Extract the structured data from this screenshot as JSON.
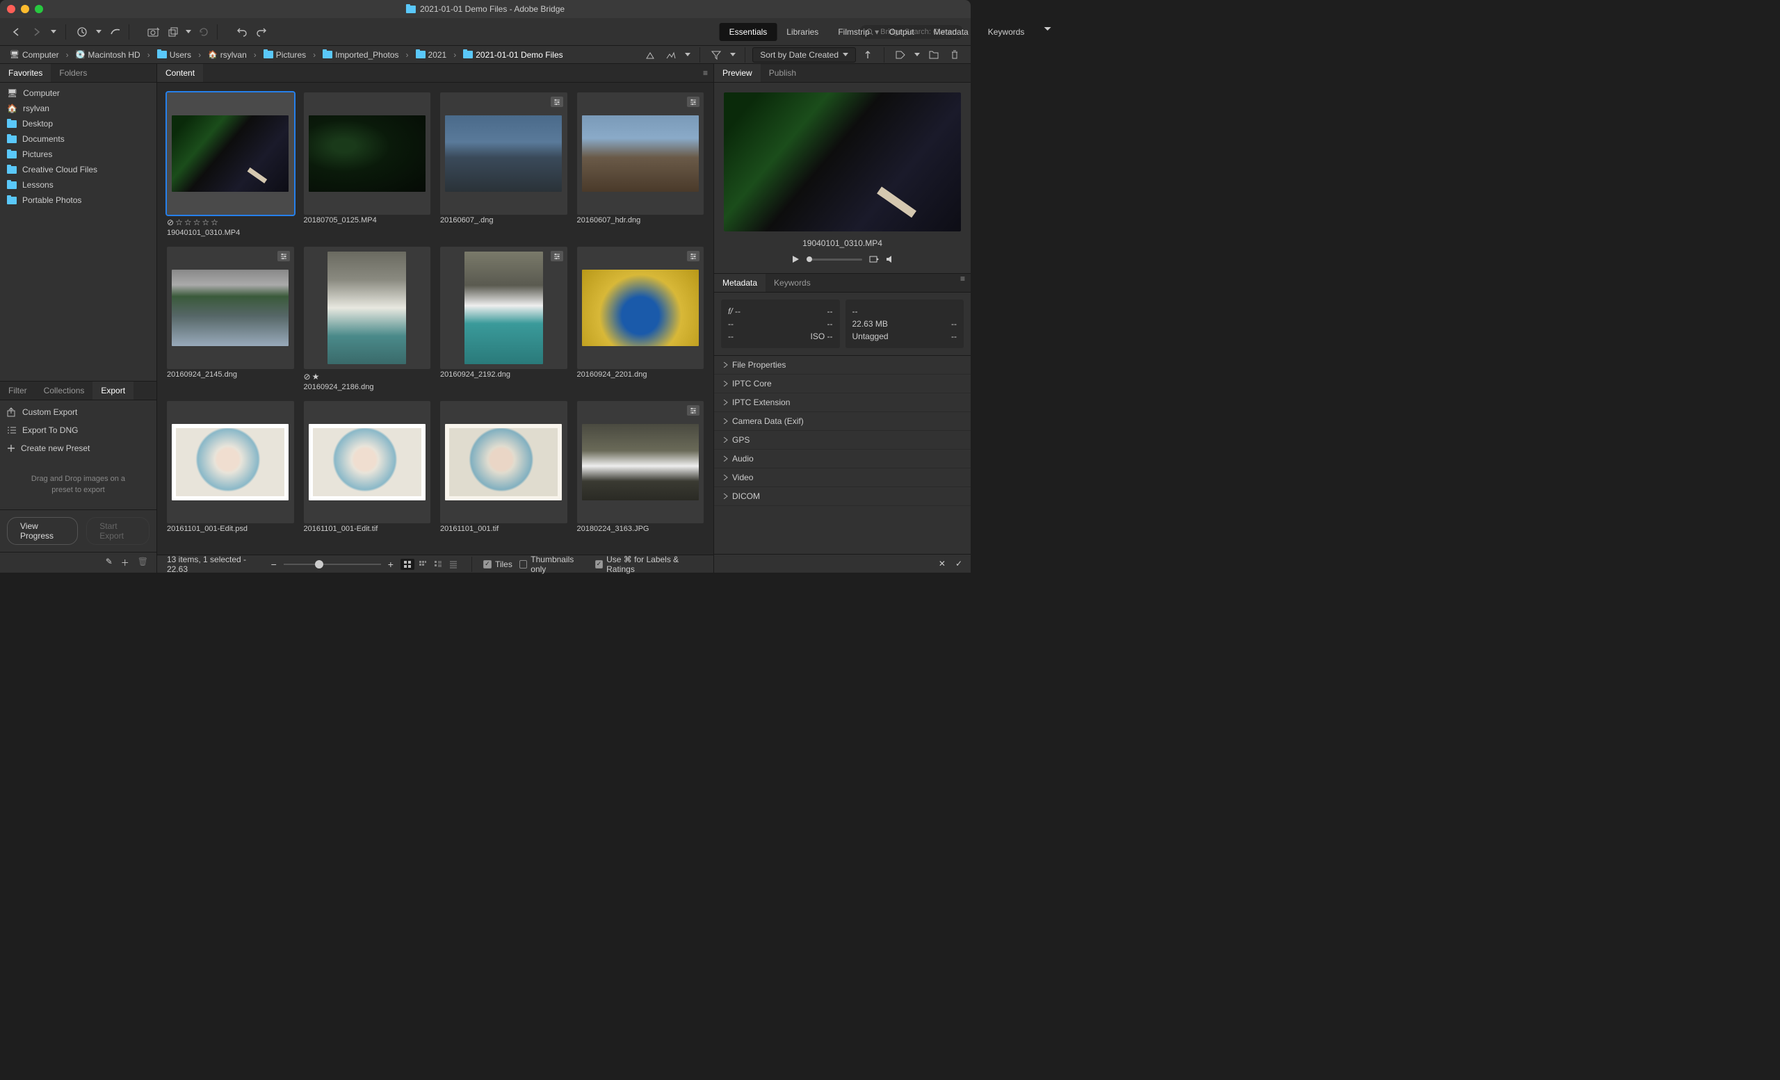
{
  "window": {
    "title": "2021-01-01 Demo Files - Adobe Bridge"
  },
  "search": {
    "placeholder": "Bridge Search: Current..."
  },
  "workspaces": [
    "Essentials",
    "Libraries",
    "Filmstrip",
    "Output",
    "Metadata",
    "Keywords"
  ],
  "breadcrumb": [
    "Computer",
    "Macintosh HD",
    "Users",
    "rsylvan",
    "Pictures",
    "Imported_Photos",
    "2021",
    "2021-01-01 Demo Files"
  ],
  "sort": {
    "label": "Sort by Date Created"
  },
  "favorites": {
    "tabs": [
      "Favorites",
      "Folders"
    ],
    "items": [
      {
        "icon": "computer",
        "label": "Computer"
      },
      {
        "icon": "home",
        "label": "rsylvan"
      },
      {
        "icon": "desktop",
        "label": "Desktop"
      },
      {
        "icon": "folder",
        "label": "Documents"
      },
      {
        "icon": "folder",
        "label": "Pictures"
      },
      {
        "icon": "folder",
        "label": "Creative Cloud Files"
      },
      {
        "icon": "folder",
        "label": "Lessons"
      },
      {
        "icon": "folder",
        "label": "Portable Photos"
      }
    ]
  },
  "export": {
    "tabs": [
      "Filter",
      "Collections",
      "Export"
    ],
    "items": [
      "Custom Export",
      "Export To DNG",
      "Create new Preset"
    ],
    "dropzone": "Drag and Drop images on a preset to export",
    "progress_btn": "View Progress",
    "start_btn": "Start Export"
  },
  "content": {
    "tab": "Content",
    "items": [
      {
        "label": "19040101_0310.MP4",
        "g": "g-aerial",
        "selected": true,
        "stars": true,
        "badge": false,
        "tall": false
      },
      {
        "label": "20180705_0125.MP4",
        "g": "g-aerial-dark",
        "selected": false,
        "stars": false,
        "badge": false,
        "tall": false
      },
      {
        "label": "20160607_.dng",
        "g": "g-city-dusk",
        "selected": false,
        "stars": false,
        "badge": true,
        "tall": false
      },
      {
        "label": "20160607_hdr.dng",
        "g": "g-city-hdr",
        "selected": false,
        "stars": false,
        "badge": true,
        "tall": false
      },
      {
        "label": "20160924_2145.dng",
        "g": "g-river",
        "selected": false,
        "stars": false,
        "badge": true,
        "tall": false
      },
      {
        "label": "20160924_2186.dng",
        "g": "g-falls",
        "selected": false,
        "stars": true,
        "badge": false,
        "tall": true,
        "one_star": true
      },
      {
        "label": "20160924_2192.dng",
        "g": "g-falls2",
        "selected": false,
        "stars": false,
        "badge": true,
        "tall": true
      },
      {
        "label": "20160924_2201.dng",
        "g": "g-aspen",
        "selected": false,
        "stars": false,
        "badge": true,
        "tall": false
      },
      {
        "label": "20161101_001-Edit.psd",
        "g": "g-baby",
        "selected": false,
        "stars": false,
        "badge": false,
        "tall": false
      },
      {
        "label": "20161101_001-Edit.tif",
        "g": "g-baby",
        "selected": false,
        "stars": false,
        "badge": false,
        "tall": false
      },
      {
        "label": "20161101_001.tif",
        "g": "g-baby2",
        "selected": false,
        "stars": false,
        "badge": false,
        "tall": false
      },
      {
        "label": "20180224_3163.JPG",
        "g": "g-stream",
        "selected": false,
        "stars": false,
        "badge": true,
        "tall": false
      }
    ]
  },
  "status": {
    "text": "13 items, 1 selected - 22.63",
    "opts": [
      "Tiles",
      "Thumbnails only",
      "Use ⌘ for Labels & Ratings"
    ]
  },
  "preview": {
    "tabs": [
      "Preview",
      "Publish"
    ],
    "label": "19040101_0310.MP4"
  },
  "metadata": {
    "tabs": [
      "Metadata",
      "Keywords"
    ],
    "card1": {
      "f": "f/",
      "a": "--",
      "b": "--",
      "c": "--",
      "d": "--",
      "e": "--",
      "iso": "ISO",
      "g": "--"
    },
    "card2": {
      "a": "--",
      "size": "22.63 MB",
      "size2": "--",
      "tag": "Untagged",
      "tag2": "--"
    },
    "sections": [
      "File Properties",
      "IPTC Core",
      "IPTC Extension",
      "Camera Data (Exif)",
      "GPS",
      "Audio",
      "Video",
      "DICOM"
    ]
  }
}
